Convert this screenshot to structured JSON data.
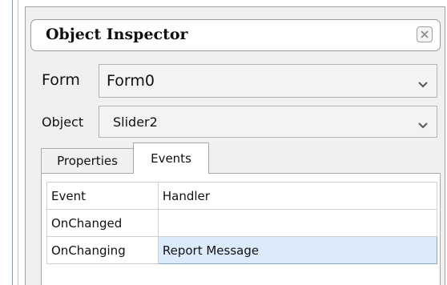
{
  "window": {
    "title": "Object Inspector"
  },
  "form_row": {
    "label": "Form",
    "value": "Form0"
  },
  "object_row": {
    "label": "Object",
    "value": "Slider2"
  },
  "tabs": [
    {
      "label": "Properties",
      "active": false
    },
    {
      "label": "Events",
      "active": true
    }
  ],
  "grid": {
    "headers": [
      "Event",
      "Handler"
    ],
    "rows": [
      {
        "event": "OnChanged",
        "handler": ""
      },
      {
        "event": "OnChanging",
        "handler": "Report Message",
        "selected": true
      }
    ]
  },
  "icons": {
    "close": "close-icon",
    "dropdown": "chevron-down-icon"
  },
  "colors": {
    "selected_cell": "#dcebfb",
    "selected_border": "#7da2ce"
  }
}
